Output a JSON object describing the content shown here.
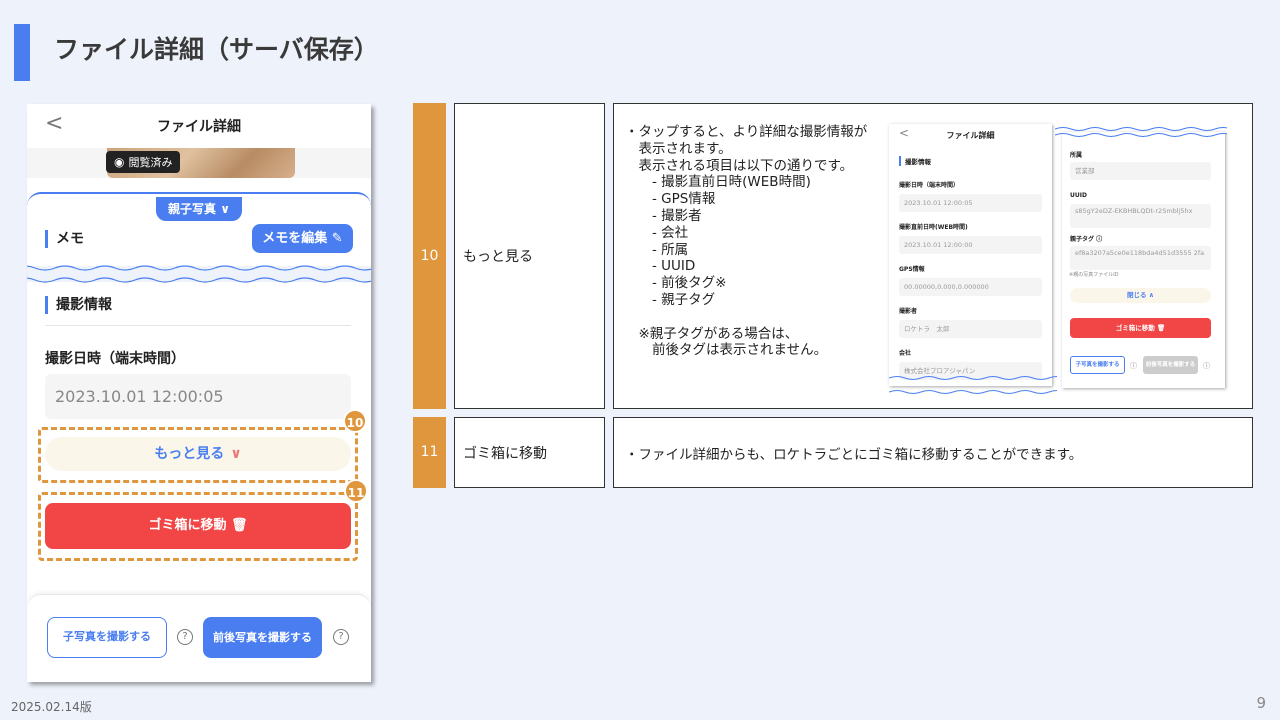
{
  "page": {
    "title": "ファイル詳細（サーバ保存）",
    "date": "2025.02.14版",
    "page_number": "9"
  },
  "phone": {
    "back_icon": "<",
    "title": "ファイル詳細",
    "viewed_badge": "閲覧済み",
    "parent_photo_pill": "親子写真 ∨",
    "memo_heading": "メモ",
    "memo_edit_button": "メモを編集 ✎",
    "shoot_info_heading": "撮影情報",
    "field_label": "撮影日時（端末時間）",
    "field_value": "2023.10.01 12:00:05",
    "more_button": "もっと見る",
    "trash_button": "ゴミ箱に移動 🗑",
    "child_photo_button": "子写真を撮影する",
    "prepost_photo_button": "前後写真を撮影する",
    "help_icon": "?"
  },
  "highlights": [
    {
      "badge": "10"
    },
    {
      "badge": "11"
    }
  ],
  "table": {
    "rows": [
      {
        "number": "10",
        "name": "もっと見る",
        "description": "・タップすると、より詳細な撮影情報が\n　表示されます。\n　表示される項目は以下の通りです。\n　　- 撮影直前日時(WEB時間)\n　　- GPS情報\n　　- 撮影者\n　　- 会社\n　　- 所属\n　　- UUID\n　　- 前後タグ※\n　　- 親子タグ\n\n　※親子タグがある場合は、\n　　前後タグは表示されません。"
      },
      {
        "number": "11",
        "name": "ゴミ箱に移動",
        "description": "・ファイル詳細からも、ロケトラごとにゴミ箱に移動することができます。"
      }
    ]
  },
  "mini_left": {
    "title": "ファイル詳細",
    "section": "撮影情報",
    "fields": [
      {
        "label": "撮影日時（端末時間）",
        "value": "2023.10.01 12:00:05"
      },
      {
        "label": "撮影直前日時(WEB時間)",
        "value": "2023.10.01 12:00:00"
      },
      {
        "label": "GPS情報",
        "value": "00.00000,0.000,0.000000"
      },
      {
        "label": "撮影者",
        "value": "ロケトラ　太郎"
      },
      {
        "label": "会社",
        "value": "株式会社プロアジャパン"
      }
    ]
  },
  "mini_right": {
    "fields": [
      {
        "label": "所属",
        "value": "営業部"
      },
      {
        "label": "UUID",
        "value": "s85gY2eDZ-EKBHBLQDt-r2Smblj5hx"
      },
      {
        "label": "親子タグ ⓘ",
        "value": "ef8a3207a5ce0e118bda4d51d3555 2fa"
      }
    ],
    "note": "※親の写真ファイルID",
    "close_button": "閉じる ∧",
    "trash_button": "ゴミ箱に移動 🗑",
    "child_button": "子写真を撮影する",
    "prepost_button": "前後写真を撮影する"
  }
}
